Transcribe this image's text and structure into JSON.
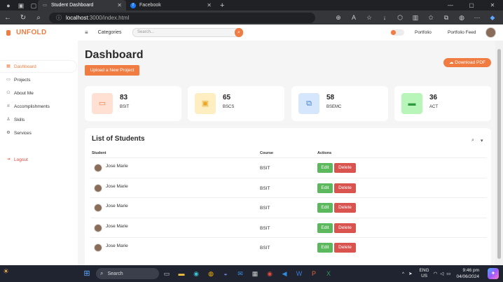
{
  "browser": {
    "tabs": [
      {
        "title": "Student Dashboard",
        "active": true
      },
      {
        "title": "Facebook",
        "active": false
      }
    ],
    "url_host": "localhost",
    "url_path": ":3000/index.html"
  },
  "app": {
    "brand": "UNFOLD",
    "sidebar": {
      "items": [
        {
          "label": "Dashboard",
          "icon": "grid-icon"
        },
        {
          "label": "Projects",
          "icon": "folder-icon"
        },
        {
          "label": "About Me",
          "icon": "user-icon"
        },
        {
          "label": "Accomplishments",
          "icon": "trophy-icon"
        },
        {
          "label": "Skills",
          "icon": "person-icon"
        },
        {
          "label": "Services",
          "icon": "gear-icon"
        }
      ],
      "logout": "Logout"
    },
    "topbar": {
      "categories": "Categories",
      "search_placeholder": "Search...",
      "links": [
        "Portfolio",
        "Portfolio Feed"
      ]
    },
    "page_title": "Dashboard",
    "upload_button": "Upload a New Project",
    "download_button": "Download PDF",
    "cards": [
      {
        "count": "83",
        "label": "BSIT",
        "bg": "#ffe0d3",
        "fg": "#f07c42",
        "icon": "terminal-icon"
      },
      {
        "count": "65",
        "label": "BSCS",
        "bg": "#ffeec2",
        "fg": "#e8a92b",
        "icon": "code-icon"
      },
      {
        "count": "58",
        "label": "BSEMC",
        "bg": "#d6e6fb",
        "fg": "#3f7fd6",
        "icon": "copy-icon"
      },
      {
        "count": "36",
        "label": "ACT",
        "bg": "#b7f5b8",
        "fg": "#2c9a3f",
        "icon": "laptop-icon"
      }
    ],
    "students": {
      "title": "List of Students",
      "headers": {
        "student": "Student",
        "course": "Course",
        "actions": "Actions"
      },
      "edit_label": "Edit",
      "delete_label": "Delete",
      "rows": [
        {
          "name": "Jose Marie",
          "course": "BSIT"
        },
        {
          "name": "Jose Marie",
          "course": "BSIT"
        },
        {
          "name": "Jose Marie",
          "course": "BSIT"
        },
        {
          "name": "Jose Marie",
          "course": "BSIT"
        },
        {
          "name": "Jose Marie",
          "course": "BSIT"
        }
      ]
    }
  },
  "taskbar": {
    "search": "Search",
    "lang": "ENG",
    "region": "US",
    "time": "9:46 pm",
    "date": "04/06/2024"
  }
}
